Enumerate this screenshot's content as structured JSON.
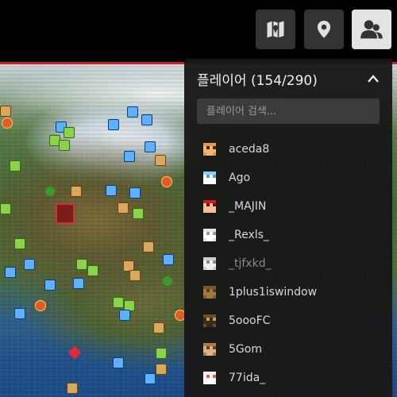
{
  "toolbar": {
    "buttons": [
      {
        "name": "map-icon"
      },
      {
        "name": "location-pin-icon"
      },
      {
        "name": "players-icon"
      }
    ]
  },
  "players_panel": {
    "title": "플레이어 (154/290)",
    "collapse_icon": "chevron-up-icon",
    "search_placeholder": "플레이어 검색...",
    "players": [
      {
        "name": "aceda8",
        "avatar_colors": [
          "#e8944a",
          "#f3b47a",
          "#3a2a1c",
          "#e8944a"
        ],
        "dim": false
      },
      {
        "name": "Ago",
        "avatar_colors": [
          "#8fd0f0",
          "#ffffff",
          "#4aa0d8",
          "#ffffff"
        ],
        "dim": false
      },
      {
        "name": "_MAJIN",
        "avatar_colors": [
          "#c81e1e",
          "#f0c0a0",
          "#7a0e0e",
          "#f0c0a0"
        ],
        "dim": false
      },
      {
        "name": "_Rexls_",
        "avatar_colors": [
          "#e6e6e6",
          "#ffffff",
          "#9a9a9a",
          "#e6e6e6"
        ],
        "dim": false
      },
      {
        "name": "_tjfxkd_",
        "avatar_colors": [
          "#cfcfcf",
          "#eeeeee",
          "#8c8c8c",
          "#cfcfcf"
        ],
        "dim": true
      },
      {
        "name": "1plus1iswindow",
        "avatar_colors": [
          "#7a5a2c",
          "#a07a3e",
          "#5a3e1c",
          "#7a5a2c"
        ],
        "dim": false
      },
      {
        "name": "5oooFC",
        "avatar_colors": [
          "#6a4a2a",
          "#3a2a18",
          "#c49a6a",
          "#6a4a2a"
        ],
        "dim": false
      },
      {
        "name": "5Gom",
        "avatar_colors": [
          "#b07a46",
          "#e0b084",
          "#6a4426",
          "#b07a46"
        ],
        "dim": false
      },
      {
        "name": "77ida_",
        "avatar_colors": [
          "#f0f0f0",
          "#ffffff",
          "#e06060",
          "#f0f0f0"
        ],
        "dim": false
      }
    ]
  },
  "colors": {
    "panel_bg": "#181818",
    "accent_red_line": "#cc1f1f",
    "active_button": "#e3e3e3",
    "inactive_button": "#333333"
  }
}
